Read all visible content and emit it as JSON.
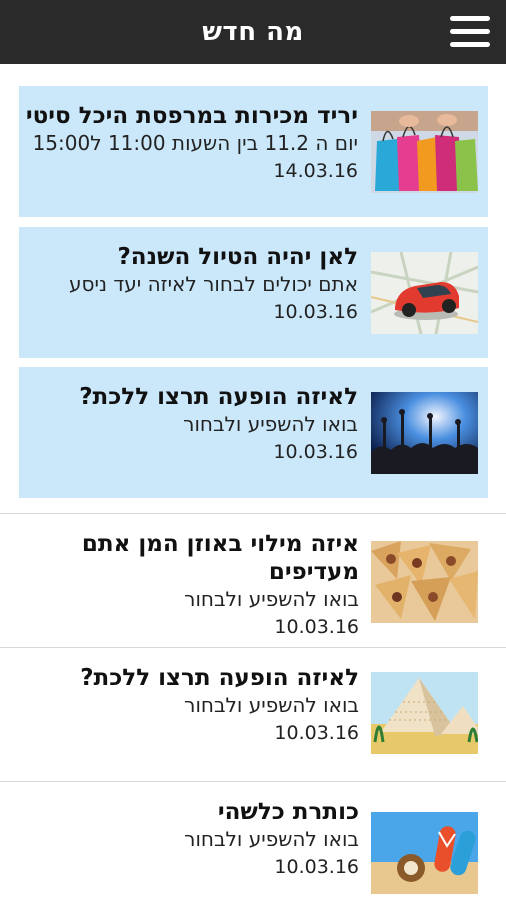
{
  "header": {
    "title": "מה חדש",
    "menu_icon": "hamburger-menu-icon"
  },
  "featured": [
    {
      "title": "יריד מכירות במרפסת היכל סיטי",
      "subtitle": "יום ה 11.2 בין השעות 11:00 ל15:00",
      "date": "14.03.16",
      "image": "shopping-bags"
    },
    {
      "title": "לאן יהיה הטיול השנה?",
      "subtitle": "אתם יכולים לבחור לאיזה יעד ניסע",
      "date": "10.03.16",
      "image": "red-car-on-map"
    },
    {
      "title": "לאיזה הופעה תרצו ללכת?",
      "subtitle": "בואו להשפיע ולבחור",
      "date": "10.03.16",
      "image": "concert-crowd"
    }
  ],
  "items": [
    {
      "title": "איזה מילוי באוזן המן אתם מעדיפים",
      "subtitle": "בואו להשפיע ולבחור",
      "date": "10.03.16",
      "image": "hamantaschen"
    },
    {
      "title": "לאיזה הופעה תרצו ללכת?",
      "subtitle": "בואו להשפיע ולבחור",
      "date": "10.03.16",
      "image": "matzah-pyramids"
    },
    {
      "title": "כותרת כלשהי",
      "subtitle": "בואו להשפיע ולבחור",
      "date": "10.03.16",
      "image": "beach-flip-flops"
    }
  ],
  "colors": {
    "header_bg": "#2a2a2a",
    "featured_bg": "#cbe8fb"
  }
}
